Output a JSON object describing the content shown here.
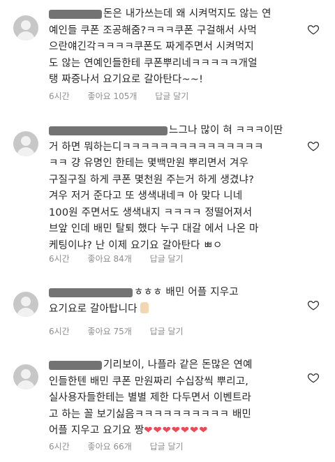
{
  "comments": [
    {
      "username": "",
      "lines": [
        "돈은 내가쓰는데 왜 시켜먹지도 않는 연",
        "예인들 쿠폰 조공해줌?ㅋㅋㅋ쿠폰 구걸해서 사먹",
        "으란얘긴각ㅋㅋㅋㅋ쿠폰도 짜게주면서 시켜먹지",
        "도 않는 연예인들한테 쿠폰뿌리네ㅋㅋㅋㅋㅋ개얼",
        "탱 짜증나서 요기요로 갈아탄다~~!"
      ],
      "time": "6시간",
      "likes": "좋아요 105개",
      "reply": "답글 달기"
    },
    {
      "username": "",
      "lines": [
        "느그나 많이 혀 ㅋㅋㅋ이딴",
        "거 하면 뭐하는디ㅋㅋㅋㅋㅋㅋㅋㅋㅋㅋㅋㅋㅋㅋㅋ",
        "ㅋㅋ 걍 유명인 한테는 몇백만원 뿌리면서 겨우",
        "구질구질 하게 쿠폰 몇천원 주는거 하게 생겼냐?",
        "겨우 저거 준다고 또 생색내네ㅋ 아 맞다 니네",
        "100원 주면서도 생색내지 ㅋㅋㅋㅋ 정떨어져서",
        "브앞 인데 배민 탈퇴 했다 누구 대갈 에서 나온 마",
        "케팅이냐? 난 이제 요기요 갈아탄다 ㅃㅇ"
      ],
      "time": "6시간",
      "likes": "좋아요 84개",
      "reply": "답글 달기"
    },
    {
      "username": "",
      "lines": [
        "ㅎㅎㅎ 배민 어플 지우고",
        "요기요로 갈아탑니다"
      ],
      "time": "6시간",
      "likes": "좋아요 75개",
      "reply": "답글 달기"
    },
    {
      "username": "",
      "lines": [
        "기리보이, 나플라 같은 돈많은 연예",
        "인들한텐 배민 쿠폰 만원짜리 수십장씩 뿌리고,",
        "실사용자들한테는 별별 제한 다두면서 이벤트라",
        "고 하는 꼴 보기싫음ㅋㅋㅋㅋㅋㅋㅋㅋㅋㅋ 배민",
        "어플 지우고 요기요 짱"
      ],
      "hearts": "❤❤❤❤❤❤❤",
      "time": "6시간",
      "likes": "좋아요 66개",
      "reply": "답글 달기"
    }
  ]
}
